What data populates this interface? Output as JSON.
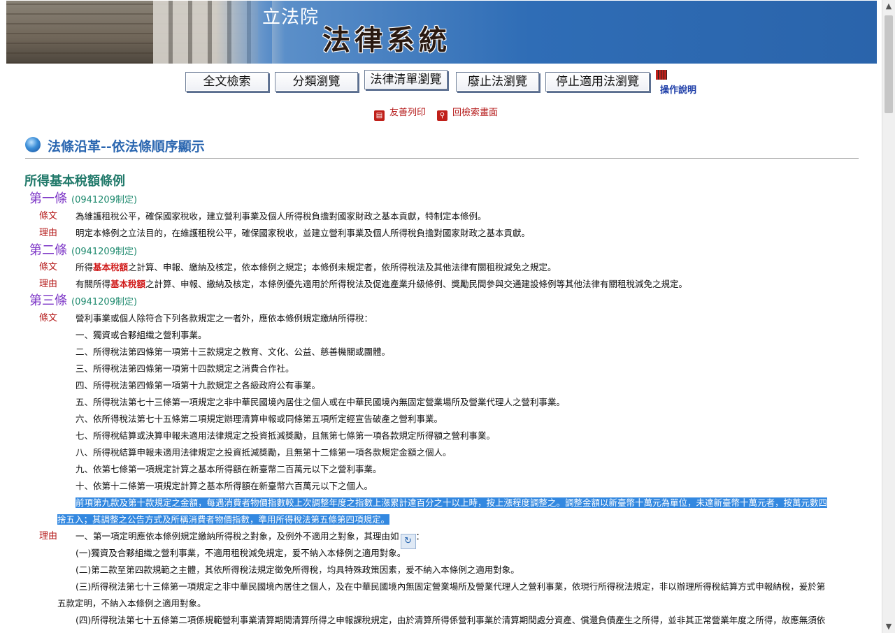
{
  "banner": {
    "org": "立法院",
    "system": "法律系統"
  },
  "nav": {
    "buttons": [
      "全文檢索",
      "分類瀏覽",
      "法律清單瀏覽",
      "廢止法瀏覽",
      "停止適用法瀏覽"
    ],
    "help": "操作說明"
  },
  "tools": {
    "print": "友善列印",
    "back": "回檢索畫面"
  },
  "section_title": "法條沿革--依法條順序顯示",
  "law_name": "所得基本稅額條例",
  "articles": [
    {
      "title": "第一條",
      "date": "(0941209制定)",
      "text_label": "條文",
      "text": "為維護租稅公平，確保國家稅收，建立營利事業及個人所得稅負擔對國家財政之基本貢獻，特制定本條例。",
      "reason_label": "理由",
      "reason": "明定本條例之立法目的，在維護租稅公平，確保國家稅收，並建立營利事業及個人所得稅負擔對國家財政之基本貢獻。"
    },
    {
      "title": "第二條",
      "date": "(0941209制定)",
      "text_label": "條文",
      "text_pre": "所得",
      "text_hl": "基本稅額",
      "text_post": "之計算、申報、繳納及核定，依本條例之規定；本條例未規定者，依所得稅法及其他法律有關租稅減免之規定。",
      "reason_label": "理由",
      "reason_pre": "有關所得",
      "reason_hl": "基本稅額",
      "reason_post": "之計算、申報、繳納及核定，本條例優先適用於所得稅法及促進產業升級條例、獎勵民間參與交通建設條例等其他法律有關租稅減免之規定。"
    },
    {
      "title": "第三條",
      "date": "(0941209制定)",
      "text_label": "條文",
      "lines": [
        "營利事業或個人除符合下列各款規定之一者外，應依本條例規定繳納所得稅：",
        "一、獨資或合夥組織之營利事業。",
        "二、所得稅法第四條第一項第十三款規定之教育、文化、公益、慈善機關或團體。",
        "三、所得稅法第四條第一項第十四款規定之消費合作社。",
        "四、所得稅法第四條第一項第十九款規定之各級政府公有事業。",
        "五、所得稅法第七十三條第一項規定之非中華民國境內居住之個人或在中華民國境內無固定營業場所及營業代理人之營利事業。",
        "六、依所得稅法第七十五條第二項規定辦理清算申報或同條第五項所定經宣告破產之營利事業。",
        "七、所得稅結算或決算申報未適用法律規定之投資抵減獎勵，且無第七條第一項各款規定所得額之營利事業。",
        "八、所得稅結算申報未適用法律規定之投資抵減獎勵，且無第十二條第一項各款規定金額之個人。",
        "九、依第七條第一項規定計算之基本所得額在新臺幣二百萬元以下之營利事業。",
        "十、依第十二條第一項規定計算之基本所得額在新臺幣六百萬元以下之個人。"
      ],
      "selected_1": "前項第九款及第十款規定之金額，每遇消費者物價指數較上次調整年度之指數上漲累計達百分之十以上時，按上漲程度調整之。調整金額以新臺幣十萬元為單位，未達新臺幣十萬元者，按萬元數四",
      "selected_2": "捨五入；其調整之公告方式及所稱消費者物價指數，準用所得稅法第五條第四項規定。",
      "reason_label": "理由",
      "reason_lead": "一、第一項定明應依本條例規定繳納所得稅之對象，及例外不適用之對象，其理由如",
      "reason_tail": "：",
      "reason_lines": [
        "(一)獨資及合夥組織之營利事業，不適用租稅減免規定，爰不納入本條例之適用對象。",
        "(二)第二款至第四款規範之主體，其依所得稅法規定徵免所得稅，均具特殊政策因素，爰不納入本條例之適用對象。"
      ],
      "reason_3a": "(三)所得稅法第七十三條第一項規定之非中華民國境內居住之個人，及在中華民國境內無固定營業場所及營業代理人之營利事業，依現行所得稅法規定，非以辦理所得稅結算方式申報納稅，爰於第",
      "reason_3b": "五款定明，不納入本條例之適用對象。",
      "reason_4a": "(四)所得稅法第七十五條第二項係規範營利事業清算期間清算所得之申報課稅規定，由於清算所得係營利事業於清算期間處分資產、償還負債產生之所得，並非其正常營業年度之所得，故應無須依"
    }
  ]
}
